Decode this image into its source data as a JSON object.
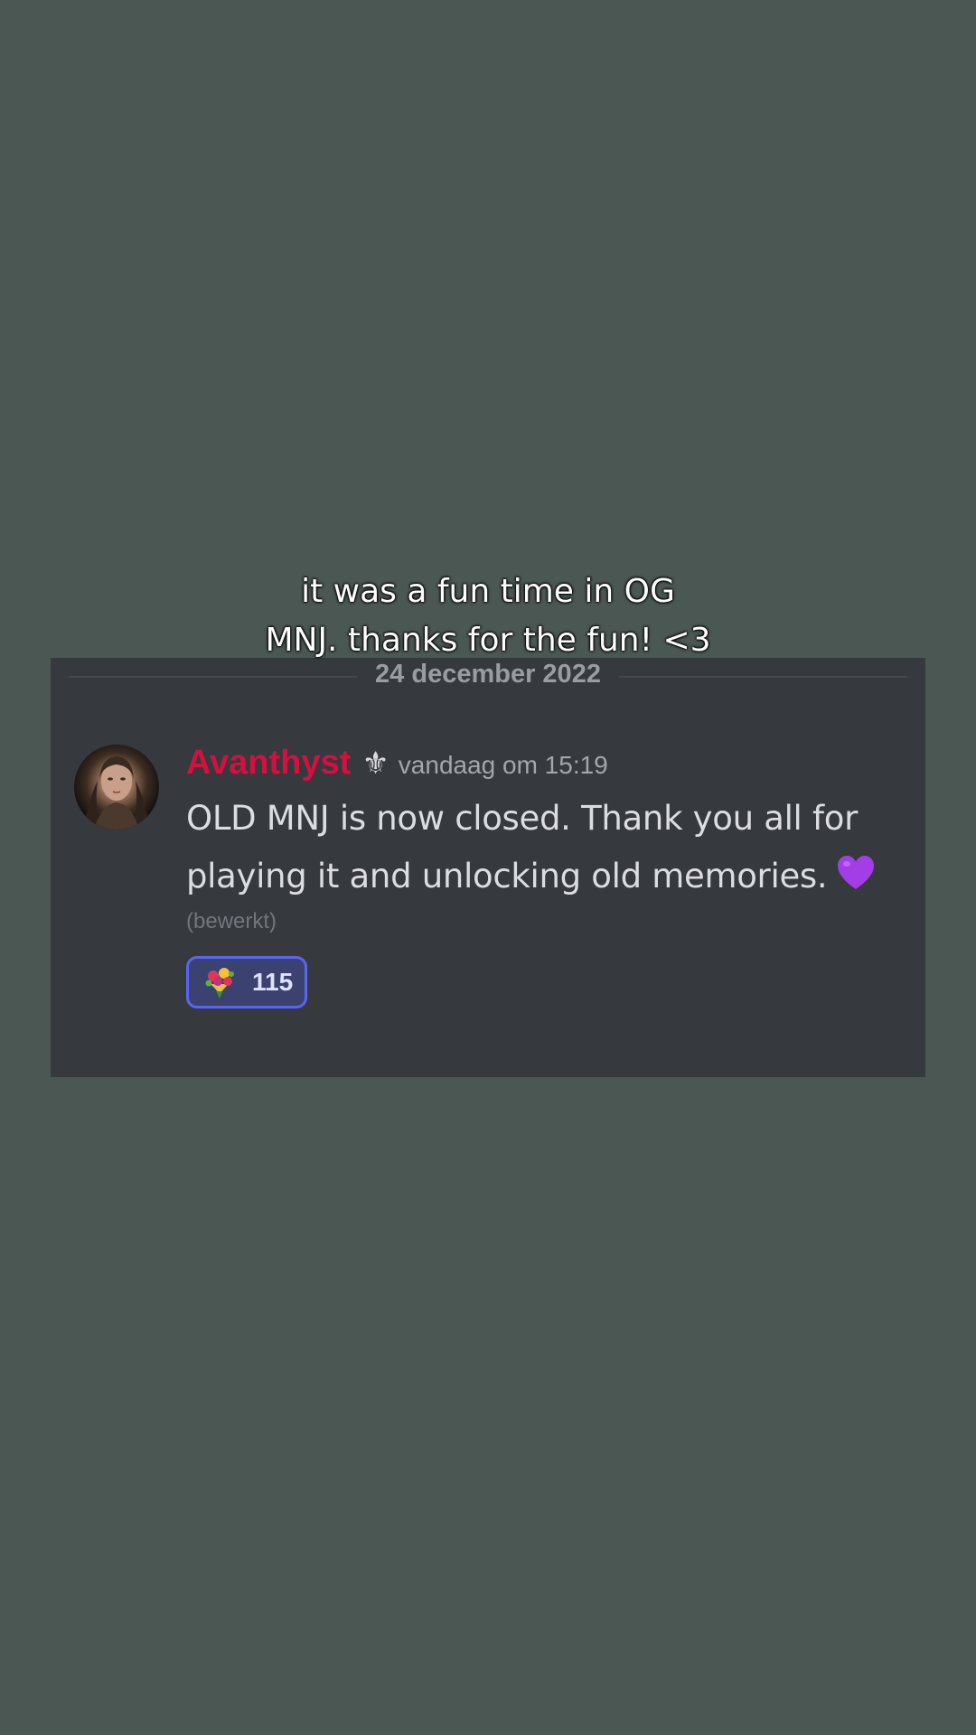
{
  "caption": {
    "line1": "it was a fun time in OG",
    "line2": "MNJ. thanks for the fun! <3"
  },
  "chat": {
    "date_divider": "24 december 2022",
    "message": {
      "username": "Avanthyst",
      "role_icon": "fleur-de-lis-icon",
      "timestamp": "vandaag om 15:19",
      "text_line1": "OLD MNJ is now closed. Thank you all for",
      "text_line2": "playing it and unlocking old memories.",
      "emoji": "purple-heart-icon",
      "edited": "(bewerkt)",
      "reaction": {
        "emoji": "bouquet-icon",
        "count": "115"
      }
    }
  },
  "colors": {
    "background": "#4b5753",
    "panel": "#36393e",
    "username": "#d4103f",
    "reaction_border": "#5865f2"
  }
}
